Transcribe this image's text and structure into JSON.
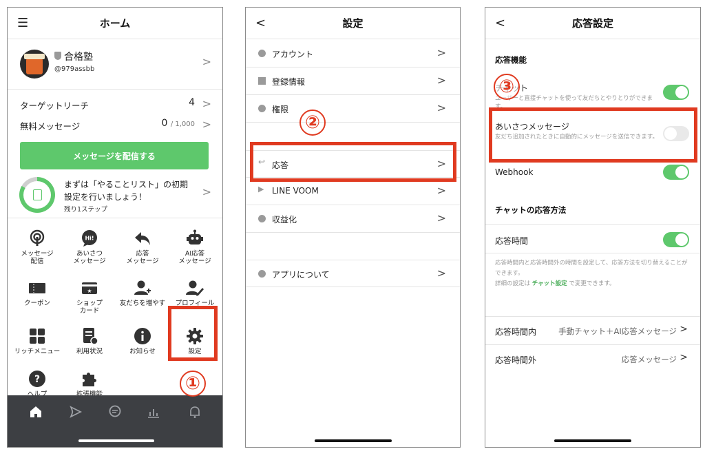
{
  "panel1": {
    "header": {
      "title": "ホーム",
      "menu_icon": "hamburger-icon"
    },
    "account": {
      "name": "合格塾",
      "id": "@979assbb"
    },
    "stats": [
      {
        "label": "ターゲットリーチ",
        "value": "4",
        "sub": ""
      },
      {
        "label": "無料メッセージ",
        "value": "0",
        "sub": "/ 1,000"
      }
    ],
    "send_button": "メッセージを配信する",
    "todo": {
      "text": "まずは「やることリスト」の初期設定を行いましょう！",
      "steps": "残り1ステップ",
      "progress_fraction": 0.83
    },
    "menu": [
      {
        "label": "メッセージ\n配信",
        "icon": "broadcast-icon"
      },
      {
        "label": "あいさつ\nメッセージ",
        "icon": "greeting-icon",
        "badge": "Hi!"
      },
      {
        "label": "応答\nメッセージ",
        "icon": "reply-icon"
      },
      {
        "label": "AI応答\nメッセージ",
        "icon": "robot-icon"
      },
      {
        "label": "クーポン",
        "icon": "coupon-icon"
      },
      {
        "label": "ショップ\nカード",
        "icon": "shop-card-icon"
      },
      {
        "label": "友だちを増やす",
        "icon": "add-friend-icon"
      },
      {
        "label": "プロフィール",
        "icon": "profile-edit-icon"
      },
      {
        "label": "リッチメニュー",
        "icon": "rich-menu-icon"
      },
      {
        "label": "利用状況",
        "icon": "usage-icon"
      },
      {
        "label": "お知らせ",
        "icon": "info-icon"
      },
      {
        "label": "設定",
        "icon": "gear-icon"
      },
      {
        "label": "ヘルプ",
        "icon": "help-icon"
      },
      {
        "label": "拡張機能",
        "icon": "puzzle-icon"
      }
    ],
    "tabs": [
      "home-icon",
      "voom-icon",
      "chat-icon",
      "analytics-icon",
      "bell-icon"
    ],
    "annotation": "①"
  },
  "panel2": {
    "header": {
      "title": "設定",
      "back": "<"
    },
    "items": [
      {
        "label": "アカウント",
        "icon": "person-icon"
      },
      {
        "label": "登録情報",
        "icon": "document-icon"
      },
      {
        "label": "権限",
        "icon": "people-icon"
      },
      {
        "label": "応答",
        "icon": "reply-icon"
      },
      {
        "label": "LINE VOOM",
        "icon": "voom-icon"
      },
      {
        "label": "収益化",
        "icon": "monetize-icon"
      },
      {
        "label": "アプリについて",
        "icon": "info-icon"
      }
    ],
    "annotation": "②"
  },
  "panel3": {
    "header": {
      "title": "応答設定",
      "back": "<"
    },
    "section1": "応答機能",
    "chat": {
      "label": "チャット",
      "sub": "ユーザーと直接チャットを使って友だちとやりとりができます。",
      "on": true
    },
    "greeting": {
      "label": "あいさつメッセージ",
      "sub": "友だち追加されたときに自動的にメッセージを送信できます。",
      "on": false
    },
    "webhook": {
      "label": "Webhook",
      "on": true
    },
    "section2": "チャットの応答方法",
    "hours": {
      "label": "応答時間",
      "on": true
    },
    "note1": "応答時間内と応答時間外の時間を設定して、応答方法を切り替えることができます。",
    "note2_pre": "詳細の設定は ",
    "note2_link": "チャット設定",
    "note2_post": " で変更できます。",
    "within": {
      "label": "応答時間内",
      "value": "手動チャット＋AI応答メッセージ"
    },
    "outside": {
      "label": "応答時間外",
      "value": "応答メッセージ"
    },
    "annotation": "③"
  },
  "chevron": ">"
}
